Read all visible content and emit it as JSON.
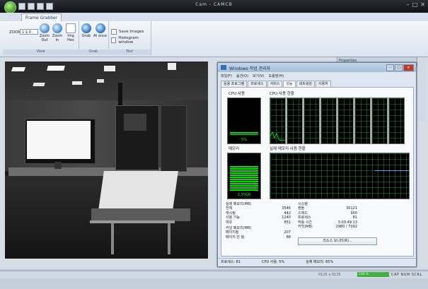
{
  "titlebar": {
    "title": "Cam - CAMCB",
    "min": "–",
    "max": "□",
    "close": "✕"
  },
  "ribbon": {
    "tab": "Frame Grabber",
    "zoom_label": "ZOOM",
    "zoom_value": "1:1.0",
    "zoom_out": "Zoom Out",
    "zoom_in": "Zoom In",
    "img_hex": "Img Hex",
    "grab": "Grab",
    "at_once": "At once",
    "save_images": "Save Images",
    "histogram_window": "Histogram window",
    "group_view": "View",
    "group_grab": "Grab",
    "group_tool": "Tool"
  },
  "side_panel": {
    "title": "Properties"
  },
  "taskmanager": {
    "title": "Windows 작업 관리자",
    "menu": [
      "파일(F)",
      "옵션(O)",
      "보기(V)",
      "도움말(H)"
    ],
    "tabs": [
      "응용 프로그램",
      "프로세스",
      "서비스",
      "성능",
      "네트워킹",
      "사용자"
    ],
    "active_tab": "성능",
    "cpu_usage_label": "CPU 사용",
    "cpu_usage_value": "5%",
    "cpu_history_label": "CPU 사용 현황",
    "memory_label": "메모리",
    "memory_value": "2.35GB",
    "memory_history_label": "실제 메모리 사용 현황",
    "physical_memory": {
      "heading": "실제 메모리(MB)",
      "rows": [
        {
          "k": "전체",
          "v": "3546"
        },
        {
          "k": "캐시됨",
          "v": "442"
        },
        {
          "k": "사용 가능",
          "v": "1240"
        },
        {
          "k": "여유",
          "v": "851"
        }
      ]
    },
    "system": {
      "heading": "시스템",
      "rows": [
        {
          "k": "핸들",
          "v": "30121"
        },
        {
          "k": "스레드",
          "v": "900"
        },
        {
          "k": "프로세스",
          "v": "81"
        },
        {
          "k": "작동 시간",
          "v": "3:03:49:13"
        },
        {
          "k": "커밋(MB)",
          "v": "2980 / 7092"
        }
      ]
    },
    "kernel_memory": {
      "heading": "커널 메모리(MB)",
      "rows": [
        {
          "k": "페이지됨",
          "v": "207"
        },
        {
          "k": "페이지 안 됨",
          "v": "88"
        }
      ]
    },
    "resource_monitor_button": "리소스 모니터(R)...",
    "status": {
      "processes": "프로세스: 81",
      "cpu": "CPU 사용: 5%",
      "memory": "실제 메모리: 65%"
    }
  },
  "statusbar": {
    "coords": "0125 x 0125",
    "progress": "100 %",
    "keys": "CAP NUM SCRL"
  }
}
